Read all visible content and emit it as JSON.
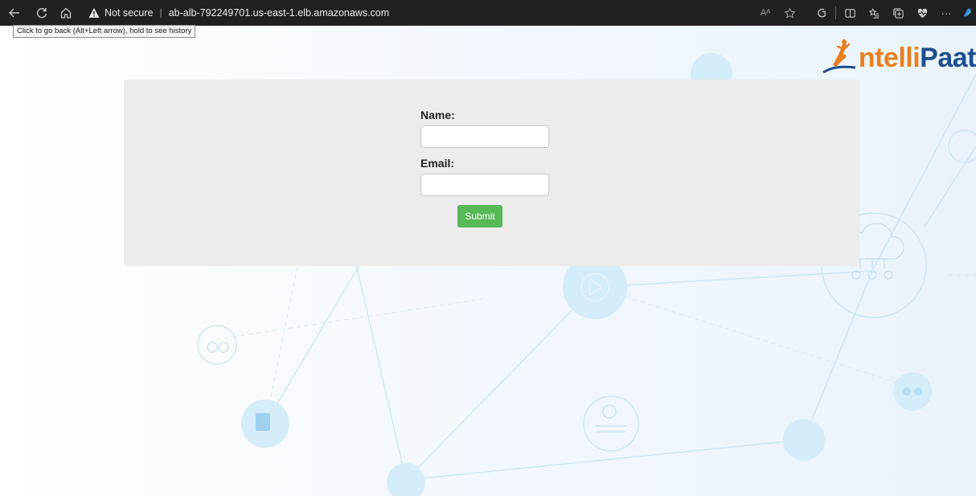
{
  "browser": {
    "back_tooltip": "Click to go back (Alt+Left arrow), hold to see history",
    "security_label": "Not secure",
    "url": "ab-alb-792249701.us-east-1.elb.amazonaws.com",
    "read_aloud_label": "Aᴬ",
    "more_label": "···"
  },
  "logo": {
    "part1": "ntelli",
    "part2": "Paat"
  },
  "form": {
    "name_label": "Name:",
    "email_label": "Email:",
    "name_value": "",
    "email_value": "",
    "submit_label": "Submit"
  },
  "colors": {
    "chrome_bg": "#202124",
    "card_bg": "#ececec",
    "submit_bg": "#56b856",
    "logo_orange": "#e8801f",
    "logo_blue": "#1f4f8f"
  }
}
